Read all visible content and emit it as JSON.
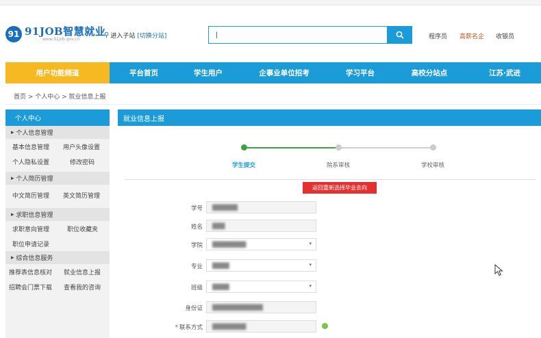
{
  "header": {
    "logo_mark": "91",
    "logo_title": "91JOB智慧就业",
    "logo_url": "www.91job.gov.cn",
    "substation_label": "进入子站",
    "switch_label": "[切换分站]",
    "search": {
      "value": "|",
      "placeholder": ""
    },
    "top_links": [
      "程序员",
      "高薪名企",
      "收银员"
    ]
  },
  "nav": {
    "items": [
      "用户功能频道",
      "平台首页",
      "学生用户",
      "企事业单位招考",
      "学习平台",
      "高校分站点",
      "江苏·武进"
    ]
  },
  "breadcrumb": "首页 > 个人中心 > 就业信息上报",
  "sidebar": {
    "title": "个人中心",
    "groups": [
      {
        "label": "个人信息管理",
        "links": [
          "基本信息管理",
          "用户头像设置",
          "个人隐私设置",
          "修改密码"
        ]
      },
      {
        "label": "个人简历管理",
        "links": [
          "中文简历管理",
          "英文简历管理"
        ]
      },
      {
        "label": "求职信息管理",
        "links": [
          "求职意向管理",
          "职位收藏夹",
          "职位申请记录"
        ]
      },
      {
        "label": "综合信息服务",
        "links": [
          "推荐表信息核对",
          "就业信息上报",
          "招聘会门票下载",
          "查看我的咨询"
        ]
      }
    ]
  },
  "main": {
    "panel_title": "就业信息上报",
    "steps": [
      "学生提交",
      "院系审核",
      "学校审核"
    ],
    "return_button": "返回重新选择毕业去向",
    "form": {
      "labels": [
        "学号",
        "姓名",
        "学院",
        "专业",
        "班级",
        "身份证",
        "联系方式"
      ],
      "values": [
        "██████",
        "███",
        "████████",
        "████",
        "████",
        "████████████",
        "████████"
      ]
    }
  },
  "colors": {
    "primary": "#1b9bd7",
    "accent": "#f6b922",
    "danger": "#e53030",
    "success": "#3da33d"
  }
}
